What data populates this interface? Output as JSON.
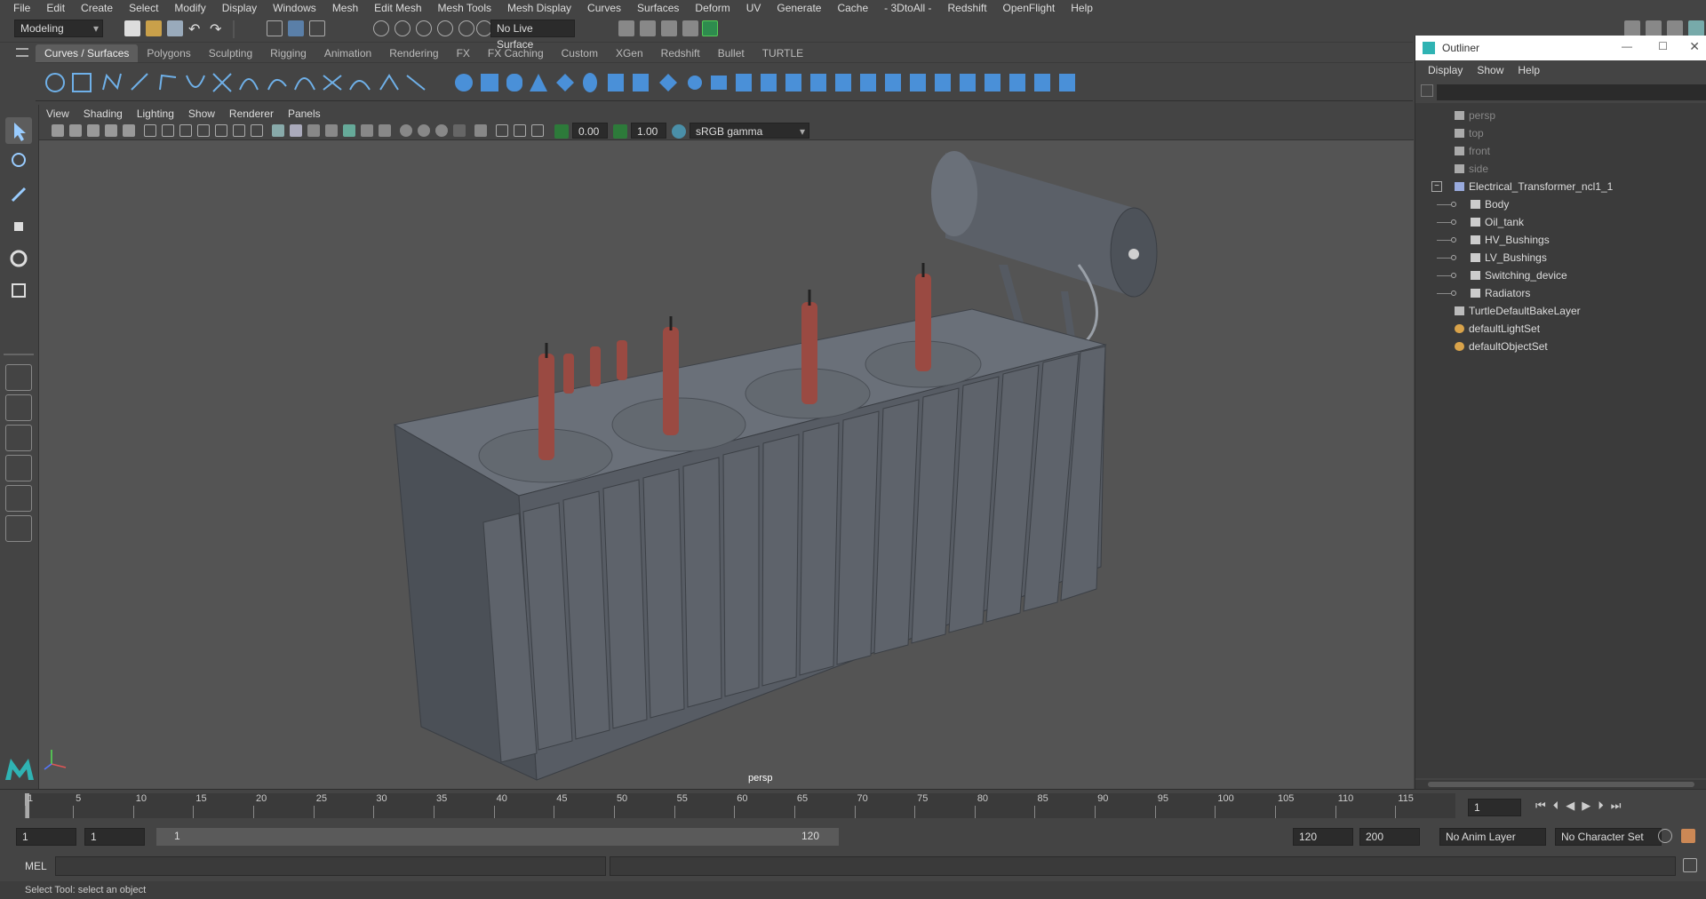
{
  "menubar": [
    "File",
    "Edit",
    "Create",
    "Select",
    "Modify",
    "Display",
    "Windows",
    "Mesh",
    "Edit Mesh",
    "Mesh Tools",
    "Mesh Display",
    "Curves",
    "Surfaces",
    "Deform",
    "UV",
    "Generate",
    "Cache",
    "- 3DtoAll -",
    "Redshift",
    "OpenFlight",
    "Help"
  ],
  "toolbar": {
    "workspace": "Modeling",
    "live_surface": "No Live Surface"
  },
  "shelf_tabs": [
    "Curves / Surfaces",
    "Polygons",
    "Sculpting",
    "Rigging",
    "Animation",
    "Rendering",
    "FX",
    "FX Caching",
    "Custom",
    "XGen",
    "Redshift",
    "Bullet",
    "TURTLE"
  ],
  "active_shelf_tab": "Curves / Surfaces",
  "viewport": {
    "menu": [
      "View",
      "Shading",
      "Lighting",
      "Show",
      "Renderer",
      "Panels"
    ],
    "exposure": "0.00",
    "gamma": "1.00",
    "color_space": "sRGB gamma",
    "camera_label": "persp"
  },
  "outliner": {
    "title": "Outliner",
    "menu": [
      "Display",
      "Show",
      "Help"
    ],
    "items": [
      {
        "label": "persp",
        "type": "camera",
        "indent": 0,
        "dim": true
      },
      {
        "label": "top",
        "type": "camera",
        "indent": 0,
        "dim": true
      },
      {
        "label": "front",
        "type": "camera",
        "indent": 0,
        "dim": true
      },
      {
        "label": "side",
        "type": "camera",
        "indent": 0,
        "dim": true
      },
      {
        "label": "Electrical_Transformer_ncl1_1",
        "type": "group",
        "indent": 0,
        "dim": false
      },
      {
        "label": "Body",
        "type": "mesh",
        "indent": 1,
        "dim": false
      },
      {
        "label": "Oil_tank",
        "type": "mesh",
        "indent": 1,
        "dim": false
      },
      {
        "label": "HV_Bushings",
        "type": "mesh",
        "indent": 1,
        "dim": false
      },
      {
        "label": "LV_Bushings",
        "type": "mesh",
        "indent": 1,
        "dim": false
      },
      {
        "label": "Switching_device",
        "type": "mesh",
        "indent": 1,
        "dim": false
      },
      {
        "label": "Radiators",
        "type": "mesh",
        "indent": 1,
        "dim": false
      },
      {
        "label": "TurtleDefaultBakeLayer",
        "type": "layer",
        "indent": 0,
        "dim": false
      },
      {
        "label": "defaultLightSet",
        "type": "set",
        "indent": 0,
        "dim": false
      },
      {
        "label": "defaultObjectSet",
        "type": "set",
        "indent": 0,
        "dim": false
      }
    ]
  },
  "timeline": {
    "ticks": [
      "1",
      "5",
      "10",
      "15",
      "20",
      "25",
      "30",
      "35",
      "40",
      "45",
      "50",
      "55",
      "60",
      "65",
      "70",
      "75",
      "80",
      "85",
      "90",
      "95",
      "100",
      "105",
      "110",
      "115"
    ],
    "current_frame": "1"
  },
  "range": {
    "start": "1",
    "playback_start": "1",
    "slider_start": "1",
    "slider_end": "120",
    "playback_end": "120",
    "end": "200",
    "anim_layer": "No Anim Layer",
    "character_set": "No Character Set"
  },
  "command_line": {
    "label": "MEL"
  },
  "status_line": "Select Tool: select an object"
}
